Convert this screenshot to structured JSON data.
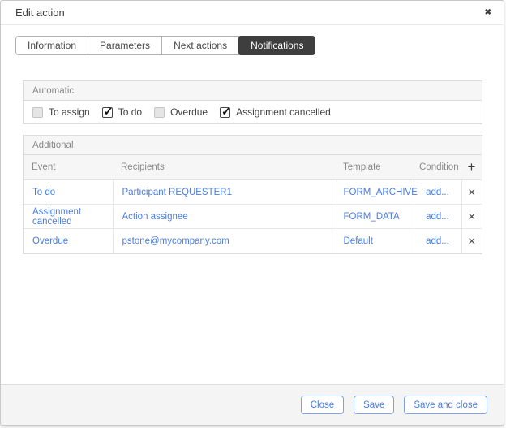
{
  "dialog": {
    "title": "Edit action"
  },
  "icons": {
    "close": "✖",
    "add": "+",
    "remove": "✕",
    "check": "✓"
  },
  "tabs": [
    {
      "label": "Information",
      "active": false
    },
    {
      "label": "Parameters",
      "active": false
    },
    {
      "label": "Next actions",
      "active": false
    },
    {
      "label": "Notifications",
      "active": true
    }
  ],
  "automatic": {
    "title": "Automatic",
    "checkboxes": [
      {
        "label": "To assign",
        "checked": false
      },
      {
        "label": "To do",
        "checked": true
      },
      {
        "label": "Overdue",
        "checked": false
      },
      {
        "label": "Assignment cancelled",
        "checked": true
      }
    ]
  },
  "additional": {
    "title": "Additional",
    "columns": [
      "Event",
      "Recipients",
      "Template",
      "Condition"
    ],
    "rows": [
      {
        "event": "To do",
        "recipients": "Participant REQUESTER1",
        "template": "FORM_ARCHIVE",
        "condition": "add..."
      },
      {
        "event": "Assignment cancelled",
        "recipients": "Action assignee",
        "template": "FORM_DATA",
        "condition": "add..."
      },
      {
        "event": "Overdue",
        "recipients": "pstone@mycompany.com",
        "template": "Default",
        "condition": "add..."
      }
    ]
  },
  "footer": {
    "buttons": [
      "Close",
      "Save",
      "Save and close"
    ]
  },
  "colors": {
    "accent-blue": "#4a7de0",
    "button-border": "#7da1ea",
    "active-tab-bg": "#3e3e3e",
    "panel-header-bg": "#f6f6f6",
    "footer-bg": "#f4f4f4"
  }
}
